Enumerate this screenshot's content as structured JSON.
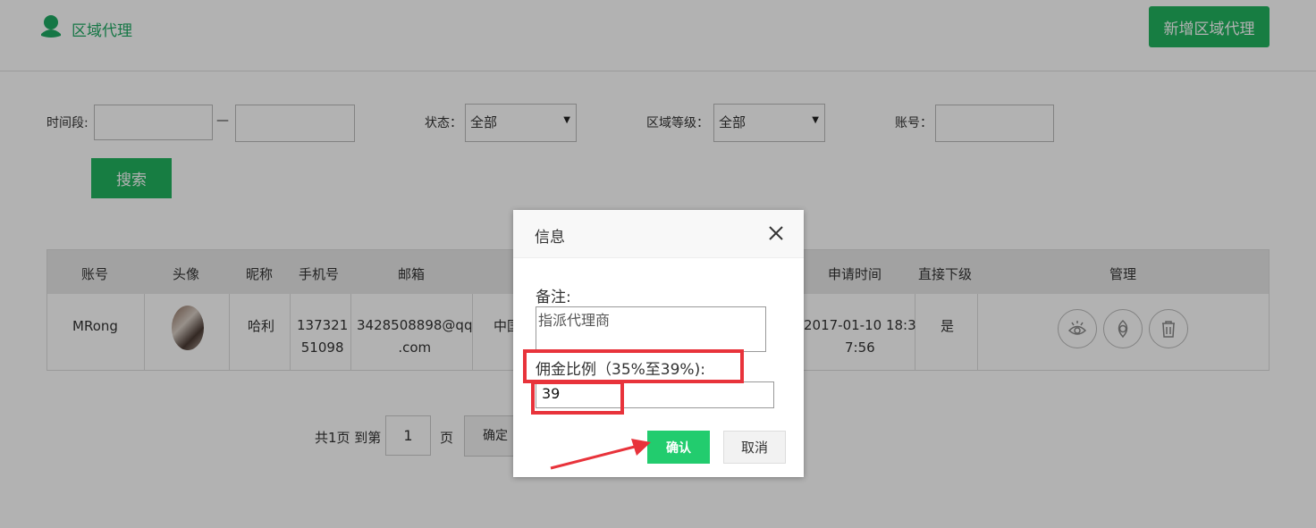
{
  "header": {
    "title": "区域代理",
    "add_button": "新增区域代理",
    "accent": "#22b35f"
  },
  "filters": {
    "time_label": "时间段:",
    "time_separator": "—",
    "status_label": "状态：",
    "status_value": "全部",
    "level_label": "区域等级：",
    "level_value": "全部",
    "account_label": "账号：",
    "search_button": "搜索"
  },
  "table": {
    "headers": [
      "账号",
      "头像",
      "昵称",
      "手机号",
      "邮箱",
      "申请时间",
      "直接下级",
      "管理"
    ],
    "row": {
      "account": "MRong",
      "nickname": "哈利",
      "phone_line1": "137321",
      "phone_line2": "51098",
      "email_line1": "3428508898@qq",
      "email_line2": ".com",
      "region_partial": "中国",
      "apply_time_line1": "2017-01-10 18:3",
      "apply_time_line2": "7:56",
      "direct_sub": "是"
    },
    "actions": [
      "view-icon",
      "commission-icon",
      "trash-icon"
    ]
  },
  "pager": {
    "total_text": "共1页 到第",
    "page_value": "1",
    "page_suffix": "页",
    "goto_button": "确定"
  },
  "dialog": {
    "title": "信息",
    "remark_label": "备注:",
    "remark_value": "指派代理商",
    "commission_label": "佣金比例（35%至39%):",
    "commission_value": "39",
    "ok_button": "确认",
    "cancel_button": "取消",
    "annotation_color": "#e8333b"
  }
}
